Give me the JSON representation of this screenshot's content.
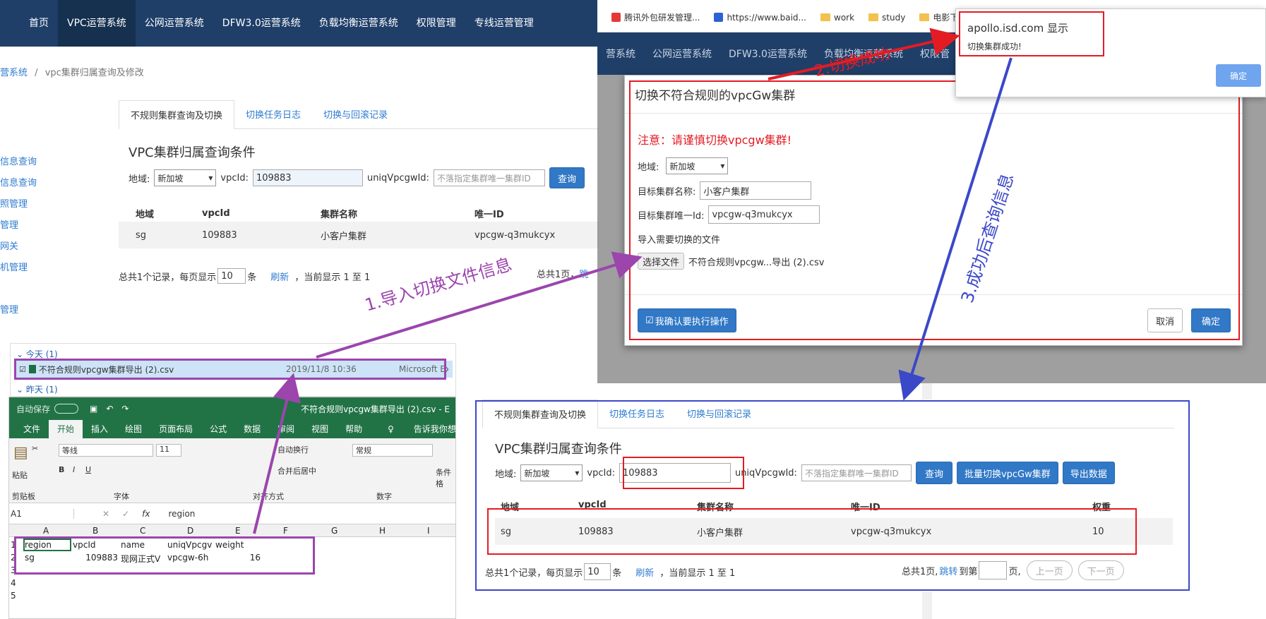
{
  "base": {
    "nav": [
      "首页",
      "VPC运营系统",
      "公网运营系统",
      "DFW3.0运营系统",
      "负载均衡运营系统",
      "权限管理",
      "专线运营管理"
    ],
    "breadcrumb": {
      "part1": "营系统",
      "sep": "/",
      "part2": "vpc集群归属查询及修改"
    },
    "sidebar": [
      "信息查询",
      "信息查询",
      "照管理",
      "管理",
      "网关",
      "机管理",
      "管理"
    ],
    "tabs": [
      "不规则集群查询及切换",
      "切换任务日志",
      "切换与回滚记录"
    ],
    "section_title": "VPC集群归属查询条件",
    "form": {
      "region_label": "地域:",
      "region_value": "新加坡",
      "vpcid_label": "vpcId:",
      "vpcid_value": "109883",
      "uniq_label": "uniqVpcgwId:",
      "uniq_placeholder": "不落指定集群唯一集群ID",
      "query": "查询"
    },
    "table": {
      "headers": [
        "地域",
        "vpcId",
        "集群名称",
        "唯一ID"
      ],
      "row": [
        "sg",
        "109883",
        "小客户集群",
        "vpcgw-q3mukcyx"
      ]
    },
    "pager": {
      "total": "总共1个记录，每页显示",
      "size": "10",
      "unit": "条",
      "refresh": "刷新",
      "current": "，当前显示 1 至 1",
      "pages": "总共1页，",
      "jump": "跳"
    }
  },
  "browser": {
    "bookmarks": [
      "腾讯外包研发管理...",
      "https://www.baid...",
      "work",
      "study",
      "电影下"
    ],
    "nav": [
      "营系统",
      "公网运营系统",
      "DFW3.0运营系统",
      "负载均衡运营系统",
      "权限管"
    ]
  },
  "alert": {
    "host": "apollo.isd.com 显示",
    "message": "切换集群成功!",
    "ok": "确定"
  },
  "modal": {
    "title": "切换不符合规则的vpcGw集群",
    "warning": "注意：请谨慎切换vpcgw集群!",
    "region_label": "地域:",
    "region_value": "新加坡",
    "target_name_label": "目标集群名称:",
    "target_name_value": "小客户集群",
    "target_id_label": "目标集群唯一Id:",
    "target_id_value": "vpcgw-q3mukcyx",
    "file_label": "导入需要切换的文件",
    "choose_file": "选择文件",
    "file_name": "不符合规则vpcgw...导出 (2).csv",
    "confirm_check": "我确认要执行操作",
    "cancel": "取消",
    "ok": "确定"
  },
  "explorer": {
    "today": "今天 (1)",
    "file": "不符合规则vpcgw集群导出 (2).csv",
    "date": "2019/11/8 10:36",
    "app": "Microsoft Exc",
    "yesterday": "昨天 (1)"
  },
  "excel": {
    "autosave": "自动保存",
    "title": "不符合规则vpcgw集群导出 (2).csv  -  E",
    "tabs": [
      "文件",
      "开始",
      "插入",
      "绘图",
      "页面布局",
      "公式",
      "数据",
      "审阅",
      "视图",
      "帮助",
      "告诉我你想要做什"
    ],
    "font": "等线",
    "size": "11",
    "wrap": "自动换行",
    "merge": "合并后居中",
    "numfmt": "常规",
    "groups": [
      "剪贴板",
      "字体",
      "对齐方式",
      "数字"
    ],
    "paste": "粘贴",
    "cond": "条件格",
    "namebox": "A1",
    "formula": "region",
    "cols": [
      "A",
      "B",
      "C",
      "D",
      "E",
      "F",
      "G",
      "H",
      "I"
    ],
    "rows": [
      "1",
      "2",
      "3",
      "4",
      "5"
    ],
    "r1": [
      "region",
      "vpcId",
      "name",
      "uniqVpcgv",
      "weight"
    ],
    "r2": [
      "sg",
      "109883",
      "现网正式V",
      "vpcgw-6h",
      "16"
    ]
  },
  "result": {
    "tabs": [
      "不规则集群查询及切换",
      "切换任务日志",
      "切换与回滚记录"
    ],
    "section_title": "VPC集群归属查询条件",
    "region_label": "地域:",
    "region_value": "新加坡",
    "vpcid_label": "vpcId:",
    "vpcid_value": "109883",
    "uniq_label": "uniqVpcgwId:",
    "uniq_placeholder": "不落指定集群唯一集群ID",
    "query": "查询",
    "batch": "批量切换vpcGw集群",
    "export": "导出数据",
    "headers": [
      "地域",
      "vpcId",
      "集群名称",
      "唯一ID",
      "权重"
    ],
    "row": [
      "sg",
      "109883",
      "小客户集群",
      "vpcgw-q3mukcyx",
      "10"
    ],
    "pager": {
      "total": "总共1个记录，每页显示",
      "size": "10",
      "unit": "条",
      "refresh": "刷新",
      "current": "，当前显示 1 至 1",
      "pages": "总共1页,",
      "jump": "跳转",
      "to": "到第",
      "page": "页,",
      "prev": "上一页",
      "next": "下一页"
    }
  },
  "annotations": {
    "step1": "1.导入切换文件信息",
    "step2": "2.切换成功",
    "step3": "3.成功后查询信息"
  },
  "colors": {
    "red": "#e31c24",
    "blue": "#3b48c8",
    "purple": "#9b45ad",
    "nav": "#1f3f69",
    "primary": "#3178c6"
  }
}
